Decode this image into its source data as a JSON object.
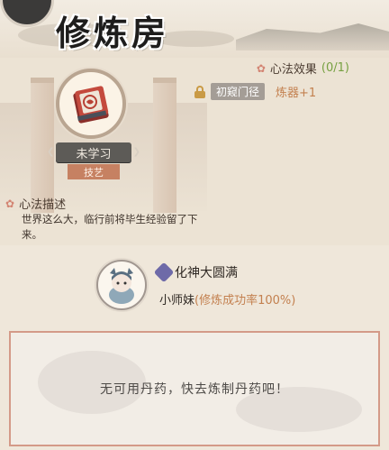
{
  "header": {
    "title": "修炼房"
  },
  "skill": {
    "status": "未学习",
    "category": "技艺",
    "effect_label": "心法效果",
    "effect_count": "(0/1)",
    "effect_tier": "初窥门径",
    "effect_bonus": "炼器+1",
    "desc_label": "心法描述",
    "desc_text": "世界这么大，临行前将毕生经验留了下来。"
  },
  "character": {
    "realm": "化神大圆满",
    "name": "小师妹",
    "success_rate": "(修炼成功率100%)"
  },
  "pills": {
    "empty_message": "无可用丹药，快去炼制丹药吧！"
  },
  "colors": {
    "accent_green": "#76a041",
    "accent_orange": "#c3804f",
    "tag_bg": "#c68162",
    "border_pink": "#d49a88"
  }
}
